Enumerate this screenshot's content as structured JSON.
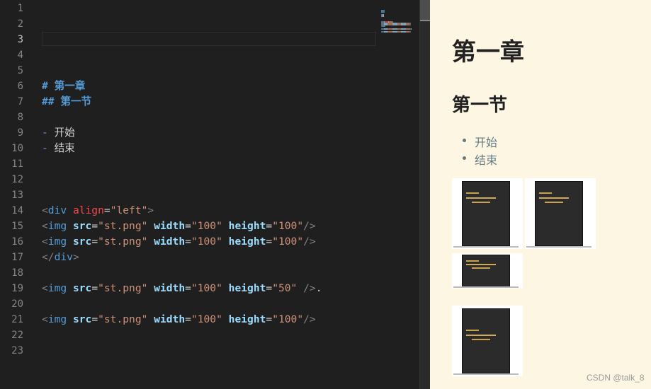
{
  "editor": {
    "active_line": 3,
    "lines": [
      {
        "n": "1",
        "tokens": []
      },
      {
        "n": "2",
        "tokens": []
      },
      {
        "n": "3",
        "tokens": []
      },
      {
        "n": "4",
        "tokens": []
      },
      {
        "n": "5",
        "tokens": []
      },
      {
        "n": "6",
        "tokens": [
          {
            "t": "# 第一章",
            "c": "t-head"
          }
        ]
      },
      {
        "n": "7",
        "tokens": [
          {
            "t": "## 第一节",
            "c": "t-head"
          }
        ]
      },
      {
        "n": "8",
        "tokens": []
      },
      {
        "n": "9",
        "tokens": [
          {
            "t": "- ",
            "c": "t-dash"
          },
          {
            "t": "开始",
            "c": "t-text"
          }
        ]
      },
      {
        "n": "10",
        "tokens": [
          {
            "t": "- ",
            "c": "t-dash"
          },
          {
            "t": "结束",
            "c": "t-text"
          }
        ]
      },
      {
        "n": "11",
        "tokens": []
      },
      {
        "n": "12",
        "tokens": []
      },
      {
        "n": "13",
        "tokens": []
      },
      {
        "n": "14",
        "tokens": [
          {
            "t": "<",
            "c": "t-punct"
          },
          {
            "t": "div",
            "c": "t-tag"
          },
          {
            "t": " ",
            "c": "t-text"
          },
          {
            "t": "align",
            "c": "t-attr-red"
          },
          {
            "t": "=",
            "c": "t-text"
          },
          {
            "t": "\"left\"",
            "c": "t-str"
          },
          {
            "t": ">",
            "c": "t-punct"
          }
        ]
      },
      {
        "n": "15",
        "tokens": [
          {
            "t": "<",
            "c": "t-punct"
          },
          {
            "t": "img",
            "c": "t-tag"
          },
          {
            "t": " ",
            "c": "t-text"
          },
          {
            "t": "src",
            "c": "t-attr"
          },
          {
            "t": "=",
            "c": "t-text"
          },
          {
            "t": "\"st.png\"",
            "c": "t-str"
          },
          {
            "t": " ",
            "c": "t-text"
          },
          {
            "t": "width",
            "c": "t-attr"
          },
          {
            "t": "=",
            "c": "t-text"
          },
          {
            "t": "\"100\"",
            "c": "t-str"
          },
          {
            "t": " ",
            "c": "t-text"
          },
          {
            "t": "height",
            "c": "t-attr"
          },
          {
            "t": "=",
            "c": "t-text"
          },
          {
            "t": "\"100\"",
            "c": "t-str"
          },
          {
            "t": "/>",
            "c": "t-punct"
          }
        ]
      },
      {
        "n": "16",
        "tokens": [
          {
            "t": "<",
            "c": "t-punct"
          },
          {
            "t": "img",
            "c": "t-tag"
          },
          {
            "t": " ",
            "c": "t-text"
          },
          {
            "t": "src",
            "c": "t-attr"
          },
          {
            "t": "=",
            "c": "t-text"
          },
          {
            "t": "\"st.png\"",
            "c": "t-str"
          },
          {
            "t": " ",
            "c": "t-text"
          },
          {
            "t": "width",
            "c": "t-attr"
          },
          {
            "t": "=",
            "c": "t-text"
          },
          {
            "t": "\"100\"",
            "c": "t-str"
          },
          {
            "t": " ",
            "c": "t-text"
          },
          {
            "t": "height",
            "c": "t-attr"
          },
          {
            "t": "=",
            "c": "t-text"
          },
          {
            "t": "\"100\"",
            "c": "t-str"
          },
          {
            "t": "/>",
            "c": "t-punct"
          }
        ]
      },
      {
        "n": "17",
        "tokens": [
          {
            "t": "</",
            "c": "t-punct"
          },
          {
            "t": "div",
            "c": "t-tag"
          },
          {
            "t": ">",
            "c": "t-punct"
          }
        ]
      },
      {
        "n": "18",
        "tokens": []
      },
      {
        "n": "19",
        "tokens": [
          {
            "t": "<",
            "c": "t-punct"
          },
          {
            "t": "img",
            "c": "t-tag"
          },
          {
            "t": " ",
            "c": "t-text"
          },
          {
            "t": "src",
            "c": "t-attr"
          },
          {
            "t": "=",
            "c": "t-text"
          },
          {
            "t": "\"st.png\"",
            "c": "t-str"
          },
          {
            "t": " ",
            "c": "t-text"
          },
          {
            "t": "width",
            "c": "t-attr"
          },
          {
            "t": "=",
            "c": "t-text"
          },
          {
            "t": "\"100\"",
            "c": "t-str"
          },
          {
            "t": " ",
            "c": "t-text"
          },
          {
            "t": "height",
            "c": "t-attr"
          },
          {
            "t": "=",
            "c": "t-text"
          },
          {
            "t": "\"50\"",
            "c": "t-str"
          },
          {
            "t": " ",
            "c": "t-text"
          },
          {
            "t": "/>",
            "c": "t-punct"
          },
          {
            "t": ".",
            "c": "t-text"
          }
        ]
      },
      {
        "n": "20",
        "tokens": []
      },
      {
        "n": "21",
        "tokens": [
          {
            "t": "<",
            "c": "t-punct"
          },
          {
            "t": "img",
            "c": "t-tag"
          },
          {
            "t": " ",
            "c": "t-text"
          },
          {
            "t": "src",
            "c": "t-attr"
          },
          {
            "t": "=",
            "c": "t-text"
          },
          {
            "t": "\"st.png\"",
            "c": "t-str"
          },
          {
            "t": " ",
            "c": "t-text"
          },
          {
            "t": "width",
            "c": "t-attr"
          },
          {
            "t": "=",
            "c": "t-text"
          },
          {
            "t": "\"100\"",
            "c": "t-str"
          },
          {
            "t": " ",
            "c": "t-text"
          },
          {
            "t": "height",
            "c": "t-attr"
          },
          {
            "t": "=",
            "c": "t-text"
          },
          {
            "t": "\"100\"",
            "c": "t-str"
          },
          {
            "t": "/>",
            "c": "t-punct"
          }
        ]
      },
      {
        "n": "22",
        "tokens": []
      },
      {
        "n": "23",
        "tokens": []
      }
    ]
  },
  "preview": {
    "h1": "第一章",
    "h2": "第一节",
    "list": [
      "开始",
      "结束"
    ]
  },
  "watermark": "CSDN @talk_8",
  "colors": {
    "editor_bg": "#1f1f1f",
    "preview_bg": "#fdf6e3",
    "heading_md": "#569cd6",
    "string": "#ce9178"
  }
}
